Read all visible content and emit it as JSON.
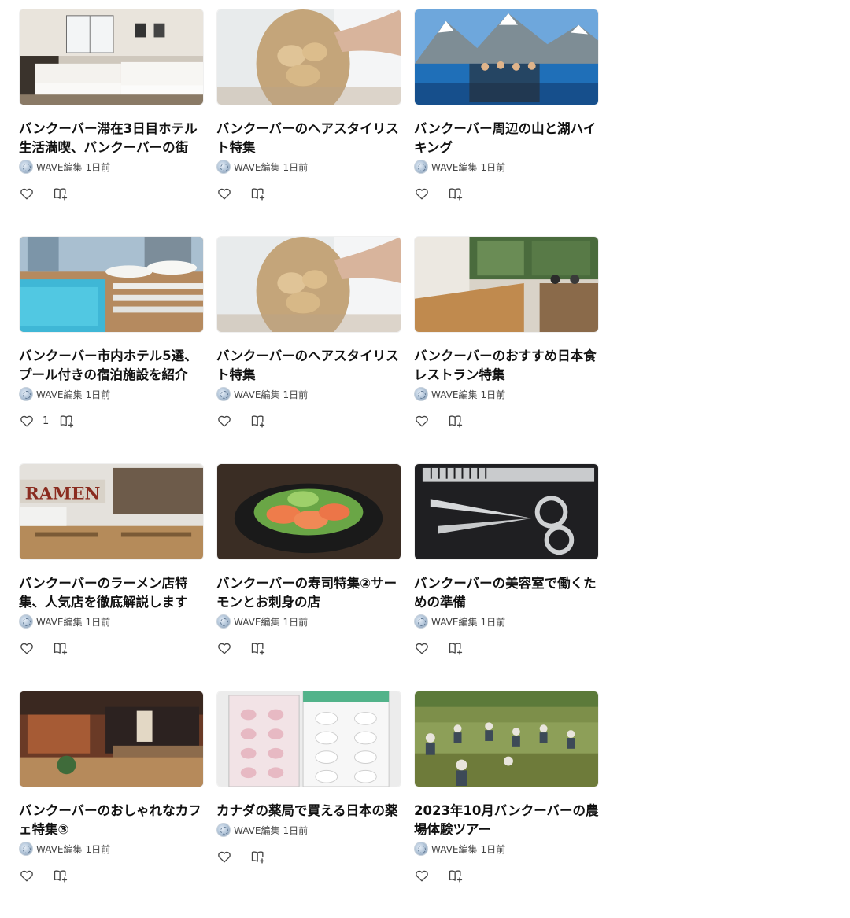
{
  "cards": [
    {
      "title": "バンクーバー滞在3日目ホテル生活満喫、バンクーバーの街",
      "author": "WAVE編集",
      "time": "1日前",
      "likes": "",
      "image": "hotel-room"
    },
    {
      "title": "バンクーバーのヘアスタイリスト特集",
      "author": "WAVE編集",
      "time": "1日前",
      "likes": "",
      "image": "hair-styling"
    },
    {
      "title": "バンクーバー周辺の山と湖ハイキング",
      "author": "WAVE編集",
      "time": "1日前",
      "likes": "",
      "image": "mountain-lake"
    },
    {
      "title": "バンクーバー市内ホテル5選、プール付きの宿泊施設を紹介",
      "author": "WAVE編集",
      "time": "1日前",
      "likes": "1",
      "image": "hotel-pool"
    },
    {
      "title": "バンクーバーのヘアスタイリスト特集",
      "author": "WAVE編集",
      "time": "1日前",
      "likes": "",
      "image": "hair-styling"
    },
    {
      "title": "バンクーバーのおすすめ日本食レストラン特集",
      "author": "WAVE編集",
      "time": "1日前",
      "likes": "",
      "image": "restaurant"
    },
    {
      "title": "バンクーバーのラーメン店特集、人気店を徹底解説します",
      "author": "WAVE編集",
      "time": "1日前",
      "likes": "",
      "image": "ramen-shop"
    },
    {
      "title": "バンクーバーの寿司特集②サーモンとお刺身の店",
      "author": "WAVE編集",
      "time": "1日前",
      "likes": "",
      "image": "salmon"
    },
    {
      "title": "バンクーバーの美容室で働くための準備",
      "author": "WAVE編集",
      "time": "1日前",
      "likes": "",
      "image": "scissors"
    },
    {
      "title": "バンクーバーのおしゃれなカフェ特集③",
      "author": "WAVE編集",
      "time": "1日前",
      "likes": "",
      "image": "cafe"
    },
    {
      "title": "カナダの薬局で買える日本の薬",
      "author": "WAVE編集",
      "time": "1日前",
      "likes": "",
      "image": "pills"
    },
    {
      "title": "2023年10月バンクーバーの農場体験ツアー",
      "author": "WAVE編集",
      "time": "1日前",
      "likes": "",
      "image": "farm"
    }
  ],
  "icons": {
    "like": "heart-icon",
    "magazine": "add-to-magazine-icon"
  }
}
